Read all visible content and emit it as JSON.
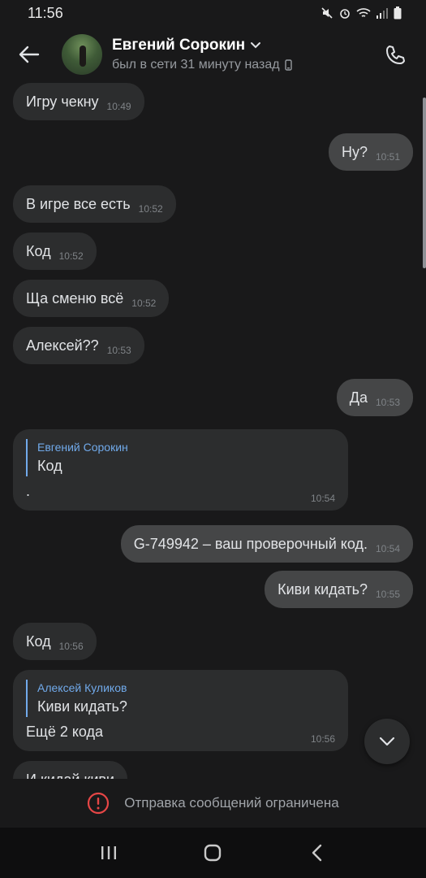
{
  "status_bar": {
    "time": "11:56"
  },
  "header": {
    "contact_name": "Евгений Сорокин",
    "contact_status": "был в сети 31 минуту назад"
  },
  "messages": [
    {
      "text": "Игру чекну",
      "time": "10:49",
      "dir": "in"
    },
    {
      "text": "Ну?",
      "time": "10:51",
      "dir": "out"
    },
    {
      "text": "В игре все есть",
      "time": "10:52",
      "dir": "in"
    },
    {
      "text": "Код",
      "time": "10:52",
      "dir": "in"
    },
    {
      "text": "Ща сменю всё",
      "time": "10:52",
      "dir": "in"
    },
    {
      "text": "Алексей??",
      "time": "10:53",
      "dir": "in"
    },
    {
      "text": "Да",
      "time": "10:53",
      "dir": "out"
    },
    {
      "quote_author": "Евгений Сорокин",
      "quote_text": "Код",
      "text": ".",
      "time": "10:54",
      "dir": "in"
    },
    {
      "text": "G-749942 – ваш проверочный код.",
      "time": "10:54",
      "dir": "out"
    },
    {
      "text": "Киви кидать?",
      "time": "10:55",
      "dir": "out"
    },
    {
      "text": "Код",
      "time": "10:56",
      "dir": "in"
    },
    {
      "quote_author": "Алексей Куликов",
      "quote_text": "Киви кидать?",
      "text": "Ещё 2 кода",
      "time": "10:56",
      "dir": "in"
    },
    {
      "text": "И кидай киви",
      "time": "",
      "dir": "in"
    }
  ],
  "footer": {
    "restricted_text": "Отправка сообщений ограничена"
  },
  "icons": {
    "back": "arrow-left-icon",
    "call": "phone-icon",
    "scroll_down": "chevron-down-icon",
    "alert": "alert-circle-icon"
  },
  "colors": {
    "accent": "#71aaeb",
    "alert": "#e64646"
  }
}
